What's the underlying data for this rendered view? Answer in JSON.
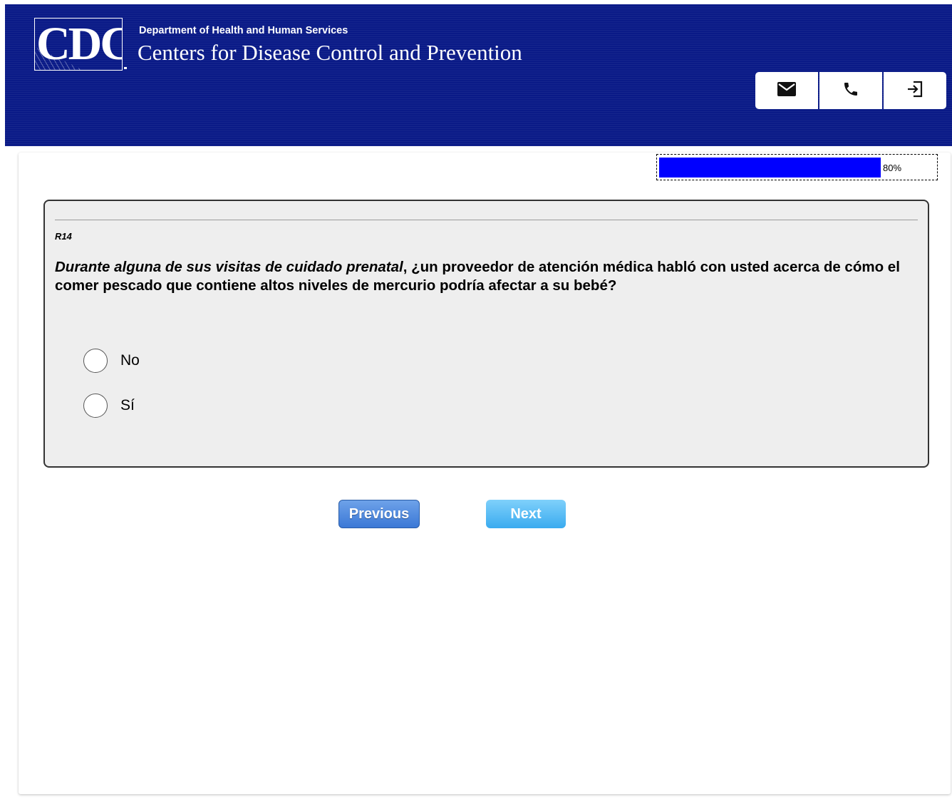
{
  "header": {
    "logo_text": "CDC",
    "department": "Department of Health and Human Services",
    "agency": "Centers for Disease Control and Prevention",
    "background_color": "#0a1a87",
    "icons": [
      "mail-icon",
      "phone-icon",
      "exit-icon"
    ]
  },
  "progress": {
    "percent": 80,
    "label": "80%",
    "fill_color": "#0000ff"
  },
  "question": {
    "id": "R14",
    "text_italic": "Durante alguna de sus visitas de cuidado prenatal",
    "text_rest": ", ¿un proveedor de atención médica habló con usted acerca de cómo el comer pescado que contiene altos niveles de mercurio podría afectar a su bebé?",
    "options": [
      {
        "label": "No",
        "selected": false
      },
      {
        "label": "Sí",
        "selected": false
      }
    ]
  },
  "nav": {
    "previous_label": "Previous",
    "next_label": "Next"
  }
}
